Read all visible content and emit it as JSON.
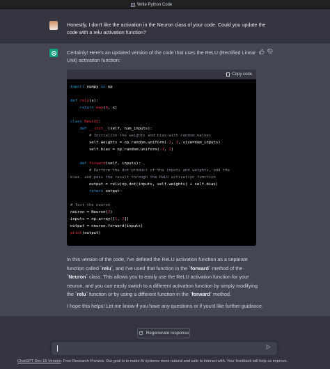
{
  "window": {
    "tab_title": "Write Python Code"
  },
  "user_message": {
    "text": "Honestly, I don't like the activation in the Neuron class of your code. Could you update the code with a  relu activation function?"
  },
  "assistant_message": {
    "intro": "Certainly! Here's an updated version of the code that uses the ReLU (Rectified Linear Unit) activation function:",
    "code_block": {
      "copy_label": "Copy code",
      "lines": [
        [
          [
            "kw",
            "import"
          ],
          [
            "t",
            " numpy "
          ],
          [
            "kw",
            "as"
          ],
          [
            "t",
            " np"
          ]
        ],
        [],
        [
          [
            "kw",
            "def"
          ],
          [
            "t",
            " "
          ],
          [
            "fn",
            "relu"
          ],
          [
            "t",
            "(x):"
          ]
        ],
        [
          [
            "t",
            "    "
          ],
          [
            "kw",
            "return"
          ],
          [
            "t",
            " "
          ],
          [
            "fn",
            "max"
          ],
          [
            "t",
            "("
          ],
          [
            "num",
            "0"
          ],
          [
            "t",
            ", x)"
          ]
        ],
        [],
        [
          [
            "kw",
            "class"
          ],
          [
            "t",
            " "
          ],
          [
            "fn",
            "Neuron"
          ],
          [
            "t",
            ":"
          ]
        ],
        [
          [
            "t",
            "    "
          ],
          [
            "kw",
            "def"
          ],
          [
            "t",
            " "
          ],
          [
            "fn",
            "__init__"
          ],
          [
            "t",
            "(self, num_inputs):"
          ]
        ],
        [
          [
            "t",
            "        "
          ],
          [
            "cm",
            "# Initialize the weights and bias with random values"
          ]
        ],
        [
          [
            "t",
            "        self.weights = np.random.uniform("
          ],
          [
            "num",
            "-1"
          ],
          [
            "t",
            ", "
          ],
          [
            "num",
            "1"
          ],
          [
            "t",
            ", size=num_inputs)"
          ]
        ],
        [
          [
            "t",
            "        self.bias = np.random.uniform("
          ],
          [
            "num",
            "-1"
          ],
          [
            "t",
            ", "
          ],
          [
            "num",
            "1"
          ],
          [
            "t",
            ")"
          ]
        ],
        [],
        [
          [
            "t",
            "    "
          ],
          [
            "kw",
            "def"
          ],
          [
            "t",
            " "
          ],
          [
            "fn",
            "forward"
          ],
          [
            "t",
            "(self, inputs):"
          ]
        ],
        [
          [
            "t",
            "        "
          ],
          [
            "cm",
            "# Perform the dot product of the inputs and weights, add the"
          ]
        ],
        [
          [
            "cm",
            "bias, and pass the result through the ReLU activation function"
          ]
        ],
        [
          [
            "t",
            "        output = relu(np.dot(inputs, self.weights) + self.bias)"
          ]
        ],
        [
          [
            "t",
            "        "
          ],
          [
            "kw",
            "return"
          ],
          [
            "t",
            " output"
          ]
        ],
        [],
        [
          [
            "cm",
            "# Test the neuron"
          ]
        ],
        [
          [
            "t",
            "neuron = Neuron("
          ],
          [
            "num",
            "2"
          ],
          [
            "t",
            ")"
          ]
        ],
        [
          [
            "t",
            "inputs = np.array(["
          ],
          [
            "num",
            "1"
          ],
          [
            "t",
            ", "
          ],
          [
            "num",
            "2"
          ],
          [
            "t",
            "])"
          ]
        ],
        [
          [
            "t",
            "output = neuron.forward(inputs)"
          ]
        ],
        [
          [
            "fn",
            "print"
          ],
          [
            "t",
            "(output)"
          ]
        ]
      ]
    },
    "explanation": [
      [
        "t",
        "In this version of the code, I've defined the ReLU activation function as a separate function called "
      ],
      [
        "b",
        "`relu`"
      ],
      [
        "t",
        ", and I've used that function in the "
      ],
      [
        "b",
        "`forward`"
      ],
      [
        "t",
        " method of the "
      ],
      [
        "b",
        "`Neuron`"
      ],
      [
        "t",
        " class. This allows you to easily use the ReLU activation function for your neuron, and you can easily switch to a different activation function by simply modifying the "
      ],
      [
        "b",
        "`relu`"
      ],
      [
        "t",
        " function or by using a different function in the "
      ],
      [
        "b",
        "`forward`"
      ],
      [
        "t",
        " method."
      ]
    ],
    "closing": "I hope this helps! Let me know if you have any questions or if you'd like further guidance."
  },
  "controls": {
    "regenerate_label": "Regenerate response",
    "input_placeholder": ""
  },
  "footer": {
    "version_link": "ChatGPT Dec 15 Version",
    "text": ". Free Research Preview. Our goal is to make AI systems more natural and safe to interact with. Your feedback will help us improve."
  },
  "icons": {
    "thumbs_up": "thumbs-up-icon",
    "thumbs_down": "thumbs-down-icon",
    "regenerate": "refresh-icon",
    "send": "send-icon",
    "copy": "clipboard-icon"
  },
  "colors": {
    "background": "#343541",
    "assistant_background": "#444654",
    "brand_green": "#10a37f",
    "code_keyword": "#2e95d3",
    "code_function": "#f22c3d",
    "code_number": "#df3079"
  }
}
